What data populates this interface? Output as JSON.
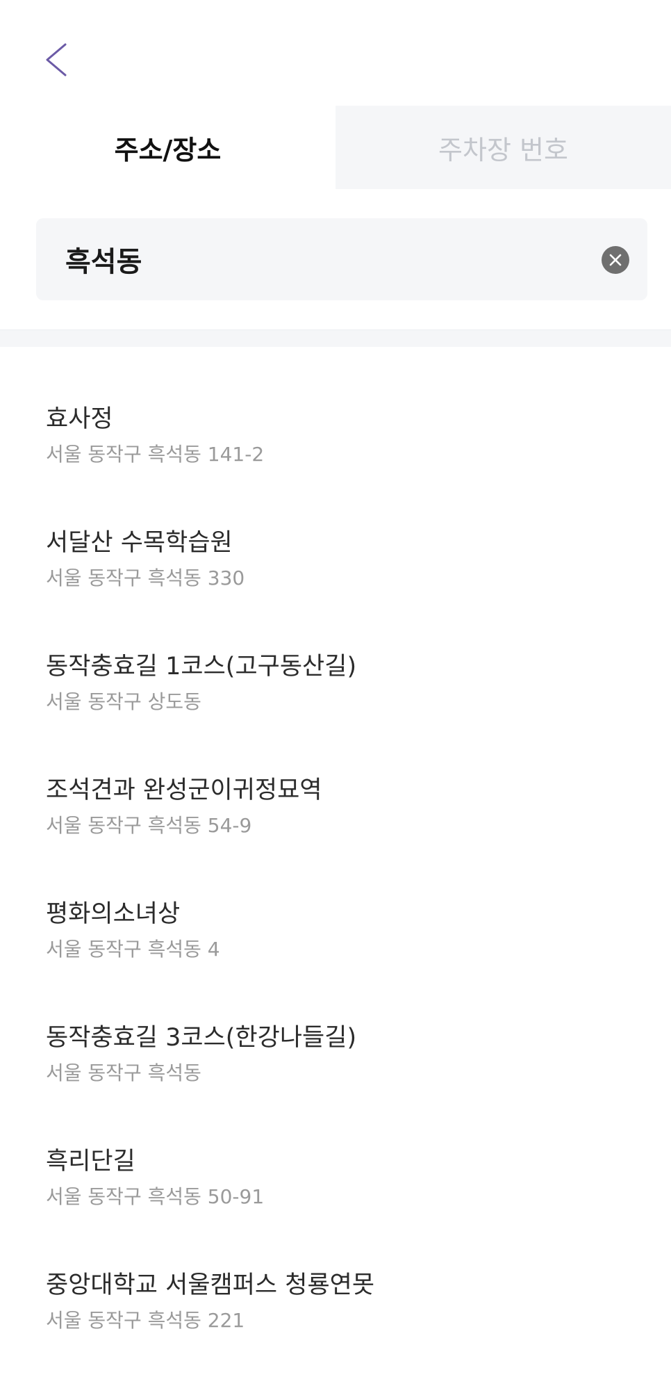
{
  "tabs": [
    {
      "label": "주소/장소",
      "active": true
    },
    {
      "label": "주차장 번호",
      "active": false
    }
  ],
  "search": {
    "value": "흑석동",
    "placeholder": ""
  },
  "results": [
    {
      "title": "효사정",
      "address": "서울 동작구 흑석동 141-2"
    },
    {
      "title": "서달산 수목학습원",
      "address": "서울 동작구 흑석동 330"
    },
    {
      "title": "동작충효길 1코스(고구동산길)",
      "address": "서울 동작구 상도동"
    },
    {
      "title": "조석견과 완성군이귀정묘역",
      "address": "서울 동작구 흑석동 54-9"
    },
    {
      "title": "평화의소녀상",
      "address": "서울 동작구 흑석동 4"
    },
    {
      "title": "동작충효길 3코스(한강나들길)",
      "address": "서울 동작구 흑석동"
    },
    {
      "title": "흑리단길",
      "address": "서울 동작구 흑석동 50-91"
    },
    {
      "title": "중앙대학교 서울캠퍼스 청룡연못",
      "address": "서울 동작구 흑석동 221"
    }
  ],
  "colors": {
    "accent": "#6b5aa6",
    "inactive_tab_bg": "#f5f6f8",
    "inactive_tab_text": "#c3c6cc",
    "address_text": "#9a9a9a"
  },
  "icons": {
    "back": "chevron-left-icon",
    "clear": "close-circle-icon"
  }
}
